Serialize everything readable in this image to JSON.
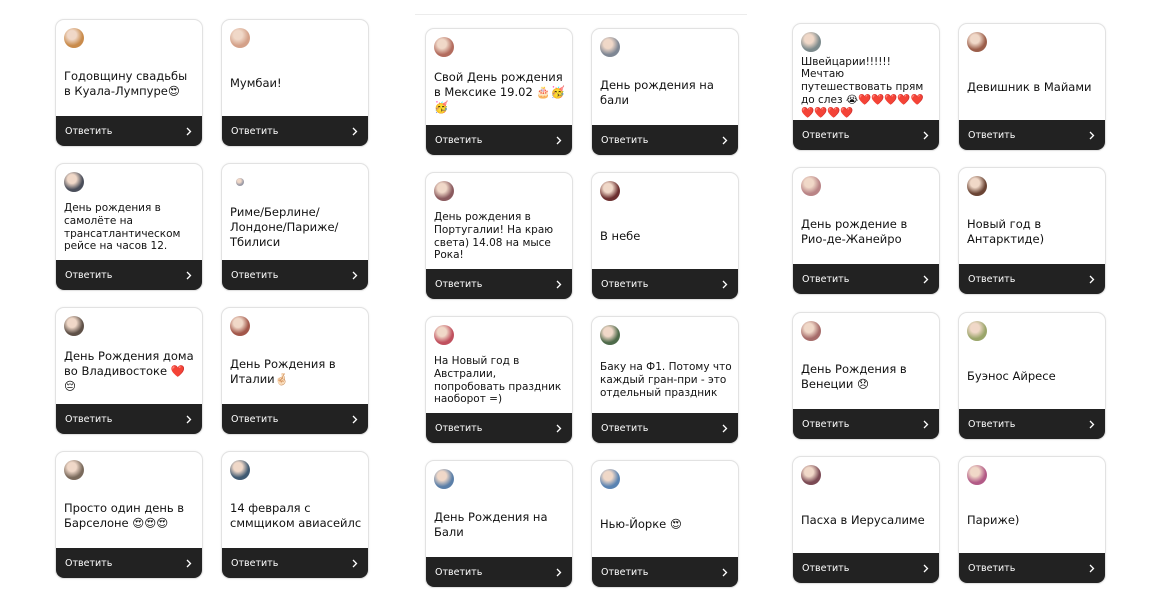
{
  "reply_label": "Ответить",
  "cards": [
    {
      "text": "Годовщину свадьбы в Куала-Лумпуре😍",
      "avatar_color": "#c98b4b"
    },
    {
      "text": "Мумбаи!",
      "avatar_color": "#d4a189"
    },
    {
      "text": "День рождения в самолёте на трансатлантическом рейсе на часов 12.",
      "avatar_color": "#4a4e5a"
    },
    {
      "text": "Риме/Берлине/ Лондоне/Париже/ Тбилиси",
      "avatar_color": "#9a9aa6"
    },
    {
      "text": "День Рождения дома во Владивостоке ❤️😔",
      "avatar_color": "#5e5047"
    },
    {
      "text": "День Рождения в Италии🤞🏻",
      "avatar_color": "#a2574a"
    },
    {
      "text": "Просто один день в Барселоне 😍😍😍",
      "avatar_color": "#7a6a5c"
    },
    {
      "text": "14 февраля с сммщиком авиасейлс",
      "avatar_color": "#405a72"
    },
    {
      "text": "Свой День рождения в Мексике 19.02 🎂🥳🥳",
      "avatar_color": "#b36c5e"
    },
    {
      "text": "День рождения на бали",
      "avatar_color": "#7f8794"
    },
    {
      "text": "День рождения в Португалии! На краю света) 14.08 на мысе Рока!",
      "avatar_color": "#8a5a5e"
    },
    {
      "text": "В небе",
      "avatar_color": "#6b2f2f"
    },
    {
      "text": "На Новый год в Австралии, попробовать праздник наоборот =)",
      "avatar_color": "#c0505e"
    },
    {
      "text": "Баку на Ф1. Потому что каждый гран-при - это отдельный праздник",
      "avatar_color": "#4e6a4a"
    },
    {
      "text": "День Рождения на Бали",
      "avatar_color": "#5b7fa8"
    },
    {
      "text": "Нью-Йорке 😍",
      "avatar_color": "#5a83b2"
    },
    {
      "text": "Швейцарии!!!!!! Мечтаю путешествовать прям до слез 😭❤️❤️❤️❤️❤️❤️❤️❤️❤️",
      "avatar_color": "#7c8a8c"
    },
    {
      "text": "Девишник в Майами",
      "avatar_color": "#9b5e4a"
    },
    {
      "text": "День рождение в Рио-де-Жанейро",
      "avatar_color": "#b98486"
    },
    {
      "text": "Новый год в Антарктиде)",
      "avatar_color": "#6a4434"
    },
    {
      "text": "День Рождения в Венеции 😞",
      "avatar_color": "#a66c6a"
    },
    {
      "text": "Буэнос Айресе",
      "avatar_color": "#9aa56a"
    },
    {
      "text": "Пасха в Иерусалиме",
      "avatar_color": "#7b4a54"
    },
    {
      "text": "Париже)",
      "avatar_color": "#b25a86"
    }
  ]
}
